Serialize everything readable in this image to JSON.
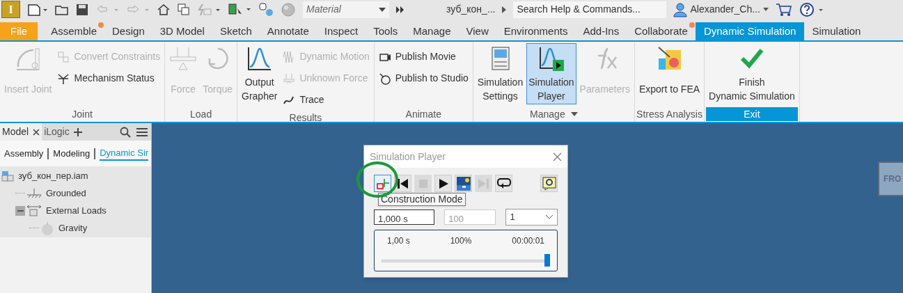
{
  "quick_access": {
    "app_letter": "I",
    "material": "Material",
    "document_title": "зуб_кон_...",
    "search_placeholder": "Search Help & Commands...",
    "user": "Alexander_Ch..."
  },
  "tabs": [
    {
      "label": "File",
      "kind": "file",
      "selected": false,
      "notification": false
    },
    {
      "label": "Assemble",
      "kind": "tab",
      "selected": false,
      "notification": true
    },
    {
      "label": "Design",
      "kind": "tab",
      "selected": false,
      "notification": false
    },
    {
      "label": "3D Model",
      "kind": "tab",
      "selected": false,
      "notification": false
    },
    {
      "label": "Sketch",
      "kind": "tab",
      "selected": false,
      "notification": false
    },
    {
      "label": "Annotate",
      "kind": "tab",
      "selected": false,
      "notification": false
    },
    {
      "label": "Inspect",
      "kind": "tab",
      "selected": false,
      "notification": false
    },
    {
      "label": "Tools",
      "kind": "tab",
      "selected": false,
      "notification": false
    },
    {
      "label": "Manage",
      "kind": "tab",
      "selected": false,
      "notification": false
    },
    {
      "label": "View",
      "kind": "tab",
      "selected": false,
      "notification": false
    },
    {
      "label": "Environments",
      "kind": "tab",
      "selected": false,
      "notification": false
    },
    {
      "label": "Add-Ins",
      "kind": "tab",
      "selected": false,
      "notification": false
    },
    {
      "label": "Collaborate",
      "kind": "tab",
      "selected": false,
      "notification": true
    },
    {
      "label": "Dynamic Simulation",
      "kind": "tab",
      "selected": true,
      "notification": false
    },
    {
      "label": "Simulation",
      "kind": "tab",
      "selected": false,
      "notification": false
    }
  ],
  "ribbon_panels": [
    {
      "title": "Joint",
      "highlighted": false,
      "dropdown": false,
      "commands": [
        {
          "kind": "large",
          "lines": [
            "Insert Joint"
          ],
          "disabled": true,
          "selected": false
        },
        {
          "kind": "small",
          "lines": [
            "Convert Constraints"
          ],
          "disabled": true
        },
        {
          "kind": "small",
          "lines": [
            "Mechanism Status"
          ],
          "disabled": false
        }
      ]
    },
    {
      "title": "Load",
      "highlighted": false,
      "dropdown": false,
      "commands": [
        {
          "kind": "large",
          "lines": [
            "Force"
          ],
          "disabled": true,
          "selected": false
        },
        {
          "kind": "large",
          "lines": [
            "Torque"
          ],
          "disabled": true,
          "selected": false
        }
      ]
    },
    {
      "title": "Results",
      "highlighted": false,
      "dropdown": false,
      "commands": [
        {
          "kind": "large",
          "lines": [
            "Output",
            "Grapher"
          ],
          "disabled": false,
          "selected": false
        },
        {
          "kind": "small",
          "lines": [
            "Dynamic Motion"
          ],
          "disabled": true
        },
        {
          "kind": "small",
          "lines": [
            "Unknown Force"
          ],
          "disabled": true
        },
        {
          "kind": "small",
          "lines": [
            "Trace"
          ],
          "disabled": false
        }
      ]
    },
    {
      "title": "Animate",
      "highlighted": false,
      "dropdown": false,
      "commands": [
        {
          "kind": "small",
          "lines": [
            "Publish Movie"
          ],
          "disabled": false
        },
        {
          "kind": "small",
          "lines": [
            "Publish to Studio"
          ],
          "disabled": false
        }
      ]
    },
    {
      "title": "Manage",
      "highlighted": false,
      "dropdown": true,
      "commands": [
        {
          "kind": "large",
          "lines": [
            "Simulation",
            "Settings"
          ],
          "disabled": false,
          "selected": false
        },
        {
          "kind": "large",
          "lines": [
            "Simulation",
            "Player"
          ],
          "disabled": false,
          "selected": true
        },
        {
          "kind": "large",
          "lines": [
            "Parameters"
          ],
          "disabled": true,
          "selected": false
        }
      ]
    },
    {
      "title": "Stress Analysis",
      "highlighted": false,
      "dropdown": false,
      "commands": [
        {
          "kind": "large",
          "lines": [
            "Export to FEA"
          ],
          "disabled": false,
          "selected": false
        }
      ]
    },
    {
      "title": "Exit",
      "highlighted": true,
      "dropdown": false,
      "commands": [
        {
          "kind": "large",
          "lines": [
            "Finish",
            "Dynamic Simulation"
          ],
          "disabled": false,
          "selected": false
        }
      ]
    }
  ],
  "browser": {
    "tabs": [
      {
        "label": "Model",
        "selected": true
      },
      {
        "label": "iLogic",
        "selected": false
      }
    ],
    "filters": [
      {
        "label": "Assembly",
        "selected": false
      },
      {
        "label": "Modeling",
        "selected": false
      },
      {
        "label": "Dynamic Sir",
        "selected": true
      }
    ],
    "tree": [
      {
        "label": "зуб_кон_пер.iam",
        "kind": "assembly",
        "children": [
          {
            "label": "Grounded",
            "kind": "grounded"
          },
          {
            "label": "External Loads",
            "kind": "loads",
            "expanded": true,
            "children": [
              {
                "label": "Gravity",
                "kind": "gravity"
              }
            ]
          }
        ]
      }
    ]
  },
  "player": {
    "title": "Simulation Player",
    "buttons": [
      {
        "kind": "construction",
        "disabled": false,
        "selected": true
      },
      {
        "kind": "rewind",
        "disabled": false,
        "selected": false
      },
      {
        "kind": "stop",
        "disabled": true,
        "selected": false
      },
      {
        "kind": "play",
        "disabled": false,
        "selected": false
      },
      {
        "kind": "render",
        "disabled": false,
        "selected": false
      },
      {
        "kind": "end",
        "disabled": true,
        "selected": false
      },
      {
        "kind": "loop",
        "disabled": false,
        "selected": false
      },
      {
        "kind": "help",
        "disabled": false,
        "selected": false
      }
    ],
    "tooltip": "Construction Mode",
    "end_time": "1,000 s",
    "steps": "100",
    "speed": "1",
    "time": "1,00 s",
    "percent": "100%",
    "elapsed": "00:00:01",
    "level": 1
  },
  "viewcube": {
    "label": "FRO"
  }
}
